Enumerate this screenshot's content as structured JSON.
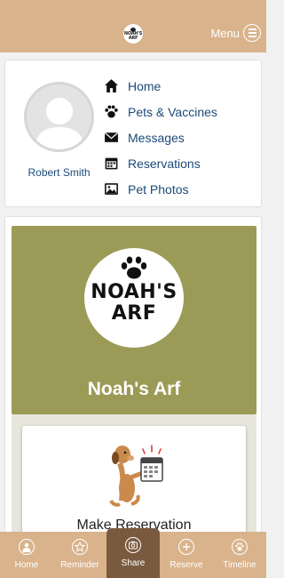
{
  "header": {
    "menu_label": "Menu",
    "logo_text": "NOAH'S ARF"
  },
  "profile": {
    "name": "Robert Smith"
  },
  "nav": [
    {
      "label": "Home",
      "icon": "home-icon"
    },
    {
      "label": "Pets & Vaccines",
      "icon": "paw-icon"
    },
    {
      "label": "Messages",
      "icon": "envelope-icon"
    },
    {
      "label": "Reservations",
      "icon": "calendar-icon"
    },
    {
      "label": "Pet Photos",
      "icon": "photo-icon"
    }
  ],
  "hero": {
    "logo_line1": "NOAH'S",
    "logo_line2": "ARF",
    "title": "Noah's Arf"
  },
  "reservation_card": {
    "label": "Make Reservation"
  },
  "tabs": [
    {
      "label": "Home",
      "icon": "avatar-icon",
      "active": false
    },
    {
      "label": "Reminder",
      "icon": "star-icon",
      "active": false
    },
    {
      "label": "Share",
      "icon": "camera-icon",
      "active": true
    },
    {
      "label": "Reserve",
      "icon": "plus-icon",
      "active": false
    },
    {
      "label": "Timeline",
      "icon": "paw-icon",
      "active": false
    }
  ],
  "colors": {
    "topbar": "#d9b38c",
    "hero": "#9b9b57",
    "link": "#1b4a7a",
    "active_tab": "#7a5a3f"
  }
}
